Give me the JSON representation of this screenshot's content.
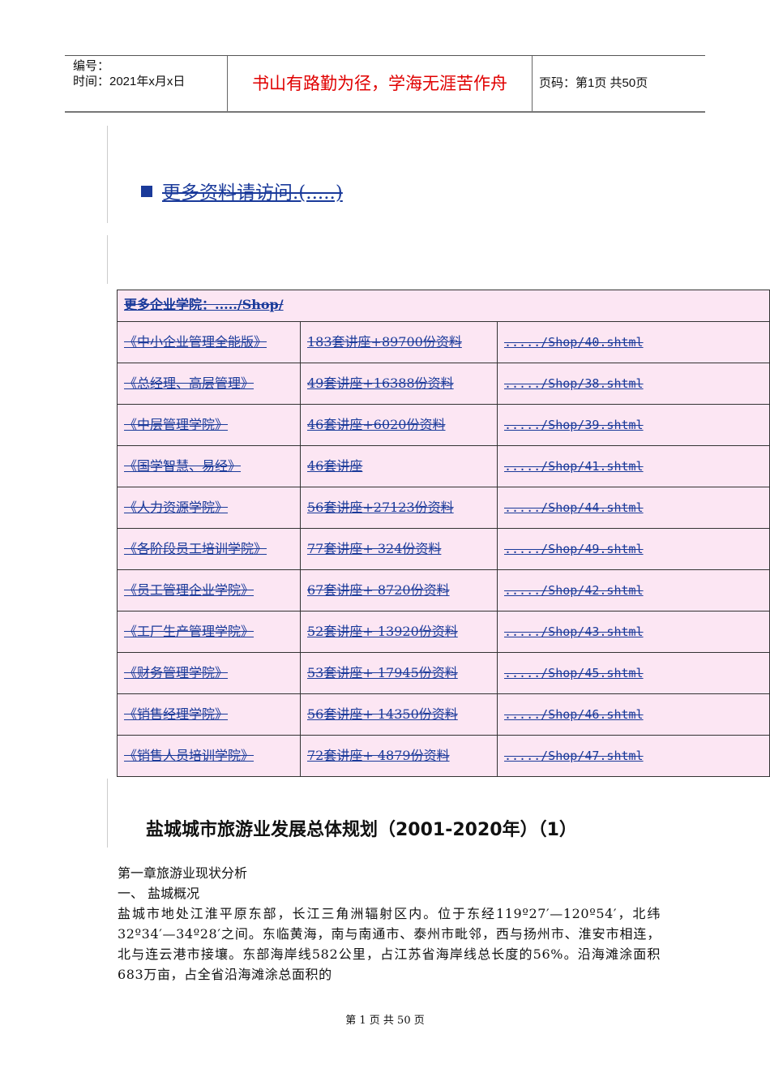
{
  "header": {
    "number_label": "编号：",
    "time_label": "时间：2021年x月x日",
    "motto": "书山有路勤为径，学海无涯苦作舟",
    "page_info": "页码：第1页  共50页"
  },
  "more_link": "更多资料请访问.(.....)",
  "table": {
    "header": "更多企业学院：...../Shop/",
    "rows": [
      [
        "《中小企业管理全能版》",
        "183套讲座+89700份资料",
        "...../Shop/40.shtml"
      ],
      [
        "《总经理、高层管理》",
        "49套讲座+16388份资料",
        "...../Shop/38.shtml"
      ],
      [
        "《中层管理学院》",
        "46套讲座+6020份资料",
        "...../Shop/39.shtml"
      ],
      [
        "《国学智慧、易经》",
        "46套讲座",
        "...../Shop/41.shtml"
      ],
      [
        "《人力资源学院》",
        "56套讲座+27123份资料",
        "...../Shop/44.shtml"
      ],
      [
        "《各阶段员工培训学院》",
        "77套讲座+ 324份资料",
        "...../Shop/49.shtml"
      ],
      [
        "《员工管理企业学院》",
        "67套讲座+ 8720份资料",
        "...../Shop/42.shtml"
      ],
      [
        "《工厂生产管理学院》",
        "52套讲座+ 13920份资料",
        "...../Shop/43.shtml"
      ],
      [
        "《财务管理学院》",
        "53套讲座+ 17945份资料",
        "...../Shop/45.shtml"
      ],
      [
        "《销售经理学院》",
        "56套讲座+ 14350份资料",
        "...../Shop/46.shtml"
      ],
      [
        "《销售人员培训学院》",
        "72套讲座+ 4879份资料",
        "...../Shop/47.shtml"
      ]
    ]
  },
  "title": "盐城城市旅游业发展总体规划（2001-2020年）（1）",
  "body": {
    "chapter": "第一章旅游业现状分析",
    "section": "一、  盐城概况",
    "paragraph": "盐城市地处江淮平原东部，长江三角洲辐射区内。位于东经119º27′—120º54′，北纬32º34′—34º28′之间。东临黄海，南与南通市、泰州市毗邻，西与扬州市、淮安市相连，北与连云港市接壤。东部海岸线582公里，占江苏省海岸线总长度的56%。沿海滩涂面积683万亩，占全省沿海滩涂总面积的"
  },
  "footer": "第 1 页 共 50 页"
}
